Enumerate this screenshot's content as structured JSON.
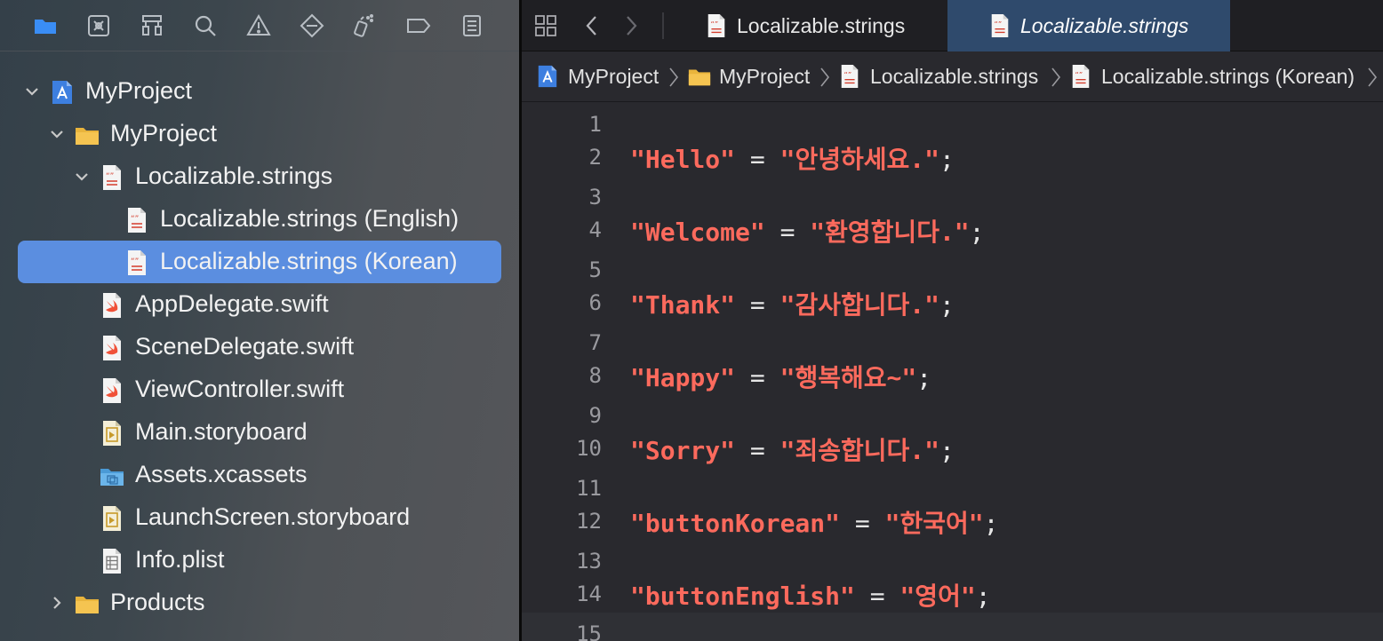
{
  "colors": {
    "accent_blue": "#3a8df5",
    "selection": "#5b8ee0",
    "string_red": "#fc6a5d",
    "active_tab": "#2f4a6c",
    "folder_yellow": "#f5c451"
  },
  "navigator": {
    "toolbar_icons": [
      "folder-icon",
      "source-control-icon",
      "symbol-hierarchy-icon",
      "search-icon",
      "warning-icon",
      "test-diamond-icon",
      "debug-spray-icon",
      "breakpoint-tag-icon",
      "report-list-icon"
    ],
    "tree": [
      {
        "label": "MyProject",
        "icon": "project-icon",
        "expanded": true
      },
      {
        "label": "MyProject",
        "icon": "folder-icon",
        "expanded": true
      },
      {
        "label": "Localizable.strings",
        "icon": "strings-file-icon",
        "expanded": true
      },
      {
        "label": "Localizable.strings (English)",
        "icon": "strings-file-icon"
      },
      {
        "label": "Localizable.strings (Korean)",
        "icon": "strings-file-icon",
        "selected": true
      },
      {
        "label": "AppDelegate.swift",
        "icon": "swift-file-icon"
      },
      {
        "label": "SceneDelegate.swift",
        "icon": "swift-file-icon"
      },
      {
        "label": "ViewController.swift",
        "icon": "swift-file-icon"
      },
      {
        "label": "Main.storyboard",
        "icon": "storyboard-file-icon"
      },
      {
        "label": "Assets.xcassets",
        "icon": "assets-folder-icon"
      },
      {
        "label": "LaunchScreen.storyboard",
        "icon": "storyboard-file-icon"
      },
      {
        "label": "Info.plist",
        "icon": "plist-file-icon"
      },
      {
        "label": "Products",
        "icon": "folder-icon",
        "expanded": false
      }
    ]
  },
  "editor": {
    "tabs": [
      {
        "label": "Localizable.strings",
        "active": false
      },
      {
        "label": "Localizable.strings",
        "active": true
      }
    ],
    "breadcrumbs": [
      "MyProject",
      "MyProject",
      "Localizable.strings",
      "Localizable.strings (Korean)"
    ],
    "lines": [
      {
        "num": "1",
        "key": "",
        "value": ""
      },
      {
        "num": "2",
        "key": "\"Hello\"",
        "value": "\"안녕하세요.\""
      },
      {
        "num": "3",
        "key": "",
        "value": ""
      },
      {
        "num": "4",
        "key": "\"Welcome\"",
        "value": "\"환영합니다.\""
      },
      {
        "num": "5",
        "key": "",
        "value": ""
      },
      {
        "num": "6",
        "key": "\"Thank\"",
        "value": "\"감사합니다.\""
      },
      {
        "num": "7",
        "key": "",
        "value": ""
      },
      {
        "num": "8",
        "key": "\"Happy\"",
        "value": "\"행복해요~\""
      },
      {
        "num": "9",
        "key": "",
        "value": ""
      },
      {
        "num": "10",
        "key": "\"Sorry\"",
        "value": "\"죄송합니다.\""
      },
      {
        "num": "11",
        "key": "",
        "value": ""
      },
      {
        "num": "12",
        "key": "\"buttonKorean\"",
        "value": "\"한국어\""
      },
      {
        "num": "13",
        "key": "",
        "value": ""
      },
      {
        "num": "14",
        "key": "\"buttonEnglish\"",
        "value": "\"영어\""
      },
      {
        "num": "15",
        "key": "",
        "value": ""
      }
    ]
  }
}
